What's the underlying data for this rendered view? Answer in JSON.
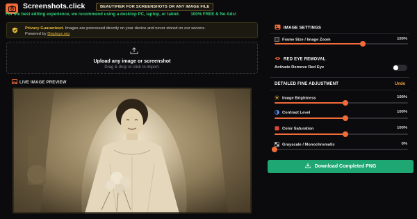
{
  "header": {
    "brand": "Screenshots.click",
    "badge": "BEAUTIFIER FOR SCREENSHOTS OR ANY IMAGE FILE",
    "tagline": "For the best editing experience, we recommend using a desktop PC, laptop, or tablet.",
    "free_note": "100% FREE & No Ads!",
    "logo_icon": "camera-icon",
    "accent": "#f26b3a",
    "tagline_color": "#2ecf77"
  },
  "privacy": {
    "strong": "Privacy Guaranteed.",
    "text": " Images are processed directly on your device and never stored on our servers.",
    "powered_prefix": "Powered by ",
    "powered_link": "Displays.org",
    "icon": "shield-check-icon"
  },
  "upload": {
    "title": "Upload any image or screenshot",
    "subtitle": "Drag & drop or click to import.",
    "icon": "upload-icon"
  },
  "preview": {
    "title": "LIVE IMAGE PREVIEW",
    "icon": "image-icon"
  },
  "settings": {
    "image_settings": {
      "title": "IMAGE SETTINGS",
      "frame_label": "Frame Size / Image Zoom",
      "frame_value": "100%",
      "frame_level": 0.66
    },
    "red_eye": {
      "title": "RED EYE REMOVAL",
      "activate_label": "Activate Remove Red Eye",
      "active": false
    },
    "fine": {
      "title": "DETAILED FINE ADJUSTMENT",
      "undo": "Undo",
      "sliders": [
        {
          "label": "Image Brightness",
          "value": "100%",
          "level": 0.53,
          "icon": "sun-icon"
        },
        {
          "label": "Contrast Level",
          "value": "100%",
          "level": 0.53,
          "icon": "contrast-icon"
        },
        {
          "label": "Color Saturation",
          "value": "100%",
          "level": 0.53,
          "icon": "palette-icon"
        },
        {
          "label": "Grayscale / Monochromatic",
          "value": "0%",
          "level": 0.0,
          "icon": "grayscale-icon"
        }
      ]
    },
    "download": {
      "label": "Download Completed PNG",
      "icon": "download-icon",
      "color": "#1fa773"
    }
  }
}
